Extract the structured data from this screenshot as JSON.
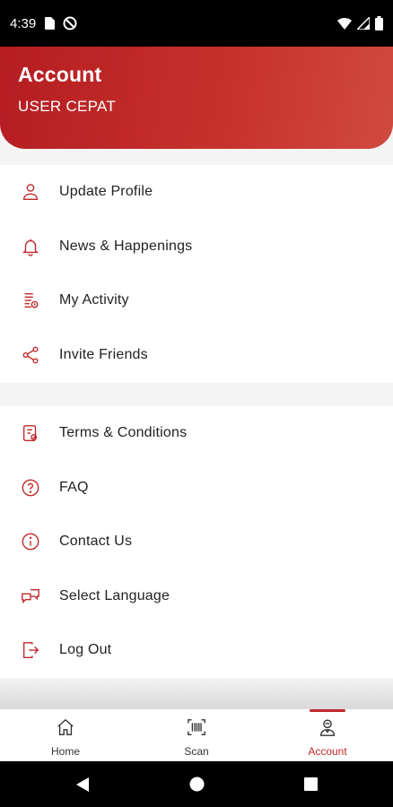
{
  "status_bar": {
    "time": "4:39"
  },
  "header": {
    "title": "Account",
    "username": "USER CEPAT"
  },
  "menu_group_1": [
    {
      "label": "Update Profile",
      "icon": "user-icon"
    },
    {
      "label": "News & Happenings",
      "icon": "bell-icon"
    },
    {
      "label": "My Activity",
      "icon": "activity-list-icon"
    },
    {
      "label": "Invite Friends",
      "icon": "share-icon"
    }
  ],
  "menu_group_2": [
    {
      "label": "Terms & Conditions",
      "icon": "document-icon"
    },
    {
      "label": "FAQ",
      "icon": "question-circle-icon"
    },
    {
      "label": "Contact Us",
      "icon": "info-circle-icon"
    },
    {
      "label": "Select Language",
      "icon": "language-icon"
    },
    {
      "label": "Log Out",
      "icon": "logout-icon"
    }
  ],
  "bottom_nav": [
    {
      "label": "Home",
      "icon": "home-icon",
      "active": false
    },
    {
      "label": "Scan",
      "icon": "barcode-icon",
      "active": false
    },
    {
      "label": "Account",
      "icon": "account-icon",
      "active": true
    }
  ],
  "colors": {
    "accent": "#c0282a",
    "header_start": "#b51d22",
    "header_end": "#d04a40"
  }
}
